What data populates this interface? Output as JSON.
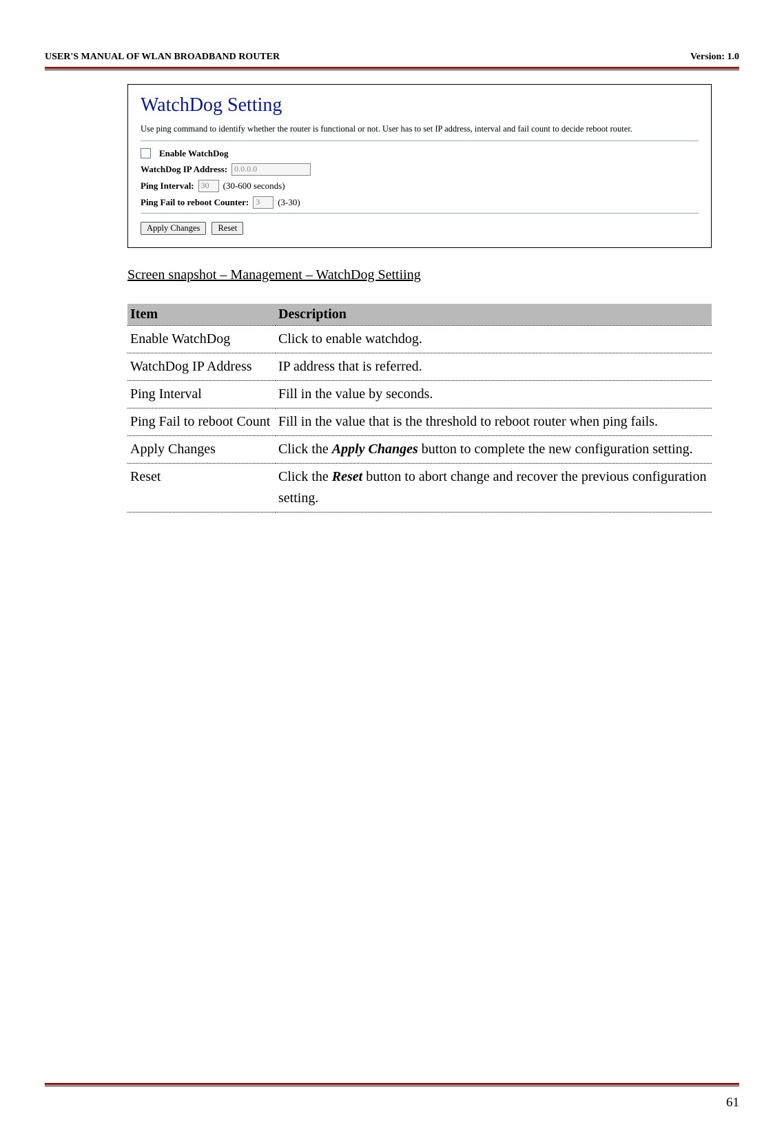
{
  "header": {
    "left": "USER'S MANUAL OF WLAN BROADBAND ROUTER",
    "right": "Version: 1.0"
  },
  "screenshot": {
    "title": "WatchDog Setting",
    "desc": "Use ping command to identify whether the router is functional or not. User has to set IP address, interval and fail count to decide reboot router.",
    "enable_label": "Enable WatchDog",
    "ip_label": "WatchDog IP Address:",
    "ip_value": "0.0.0.0",
    "interval_label": "Ping Interval:",
    "interval_value": "30",
    "interval_hint": "(30-600 seconds)",
    "fail_label": "Ping Fail to reboot Counter:",
    "fail_value": "3",
    "fail_hint": "(3-30)",
    "apply_btn": "Apply Changes",
    "reset_btn": "Reset"
  },
  "caption": "Screen snapshot – Management – WatchDog Settiing",
  "table": {
    "head_item": "Item",
    "head_desc": "Description",
    "rows": [
      {
        "item": "Enable WatchDog",
        "desc_plain": "Click to enable watchdog."
      },
      {
        "item": "WatchDog IP Address",
        "desc_plain": "IP address that is referred."
      },
      {
        "item": "Ping Interval",
        "desc_plain": "Fill in the value by seconds."
      },
      {
        "item": "Ping Fail to reboot Count",
        "desc_plain": "Fill in the value that is the threshold to reboot router when ping fails."
      },
      {
        "item": "Apply Changes",
        "desc_pre": "Click the ",
        "desc_bi": "Apply Changes",
        "desc_post": " button to complete the new configuration setting."
      },
      {
        "item": "Reset",
        "desc_pre": "Click the ",
        "desc_bi": "Reset",
        "desc_post": " button to abort change and recover the previous configuration setting."
      }
    ]
  },
  "page_number": "61"
}
